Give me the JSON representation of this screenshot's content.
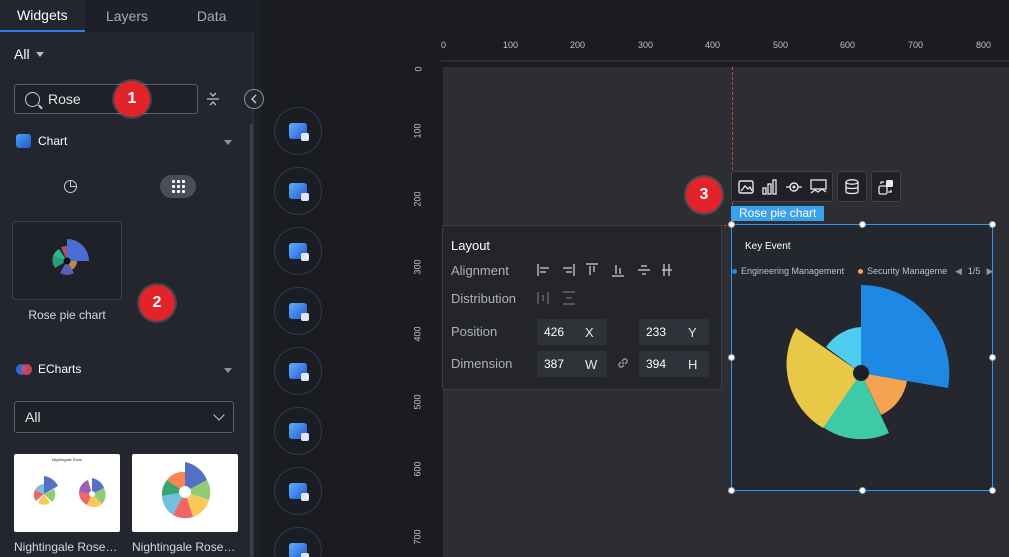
{
  "tabs": [
    {
      "label": "Widgets",
      "active": true
    },
    {
      "label": "Layers",
      "active": false
    },
    {
      "label": "Data",
      "active": false
    }
  ],
  "filter": {
    "label": "All"
  },
  "search": {
    "value": "Rose"
  },
  "sections": {
    "chart": {
      "label": "Chart"
    },
    "echarts": {
      "label": "ECharts"
    }
  },
  "widgets": [
    {
      "label": "Rose pie chart"
    }
  ],
  "echarts_filter": {
    "value": "All"
  },
  "echarts_items": [
    {
      "label": "Nightingale Rose…",
      "thumb_title": "Nightingale Rose"
    },
    {
      "label": "Nightingale Rose…"
    }
  ],
  "callouts": [
    "1",
    "2",
    "3"
  ],
  "ruler": {
    "x": [
      "0",
      "100",
      "200",
      "300",
      "400",
      "500",
      "600",
      "700",
      "800"
    ],
    "y": [
      "0",
      "100",
      "200",
      "300",
      "400",
      "500",
      "600",
      "700"
    ]
  },
  "selection": {
    "tag": "Rose pie chart"
  },
  "layout_panel": {
    "title": "Layout",
    "alignment_label": "Alignment",
    "distribution_label": "Distribution",
    "position_label": "Position",
    "dimension_label": "Dimension",
    "x": "426",
    "x_axis": "X",
    "y": "233",
    "y_axis": "Y",
    "w": "387",
    "w_axis": "W",
    "h": "394",
    "h_axis": "H"
  },
  "chart_widget": {
    "title": "Key Event",
    "legend": [
      {
        "name": "Engineering Management",
        "color": "#1e88e5"
      },
      {
        "name": "Security Manageme",
        "color": "#f5a351"
      }
    ],
    "pager": "1/5"
  },
  "colors": {
    "accent": "#2f80ed",
    "selection": "#2f9bf0",
    "callout": "#e2232a",
    "guide": "#d2453a"
  },
  "icons": {
    "tools": [
      "image-icon",
      "bar-chart-icon",
      "eye-icon",
      "monitor-chart-icon",
      "database-icon",
      "interaction-icon"
    ]
  }
}
